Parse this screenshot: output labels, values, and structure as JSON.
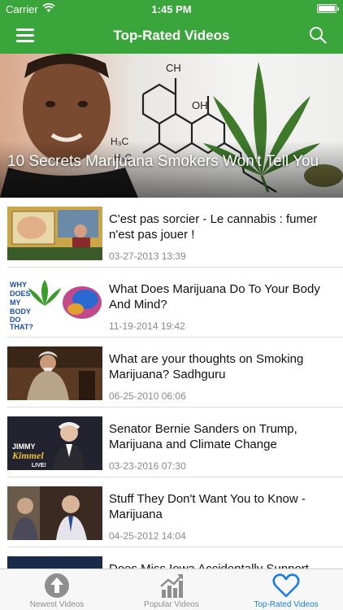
{
  "status_bar": {
    "carrier": "Carrier",
    "time": "1:45 PM"
  },
  "nav": {
    "title": "Top-Rated Videos",
    "menu_icon": "hamburger-icon",
    "search_icon": "search-icon"
  },
  "colors": {
    "brand_green": "#3aa53a",
    "active_tab": "#1a7fe0",
    "inactive_tab": "#8e8e8e"
  },
  "featured": {
    "title": "10 Secrets Marijuana Smokers Won't Tell You"
  },
  "videos": [
    {
      "title": "C'est pas sorcier - Le cannabis : fumer n'est pas jouer !",
      "date": "03-27-2013 13:39"
    },
    {
      "title": "What Does Marijuana Do To Your Body And Mind?",
      "date": "11-19-2014 19:42"
    },
    {
      "title": "What are your thoughts on Smoking Marijuana? Sadhguru",
      "date": "06-25-2010 06:06"
    },
    {
      "title": "Senator Bernie Sanders on Trump, Marijuana and Climate Change",
      "date": "03-23-2016 07:30"
    },
    {
      "title": "Stuff They Don't Want You to Know - Marijuana",
      "date": "04-25-2012 14:04"
    },
    {
      "title": "Does Miss Iowa Accidentally Support",
      "date": ""
    }
  ],
  "thumbnail_text": {
    "video_2": [
      "WHY",
      "DOES",
      "MY",
      "BODY",
      "DO",
      "THAT?"
    ],
    "video_4": [
      "JIMMY",
      "Kimmel",
      "LIVE!"
    ]
  },
  "tabs": [
    {
      "label": "Newest Videos",
      "icon": "arrow-up-circle-icon"
    },
    {
      "label": "Popular Videos",
      "icon": "chart-icon"
    },
    {
      "label": "Top-Rated Videos",
      "icon": "heart-icon",
      "active": true
    }
  ]
}
